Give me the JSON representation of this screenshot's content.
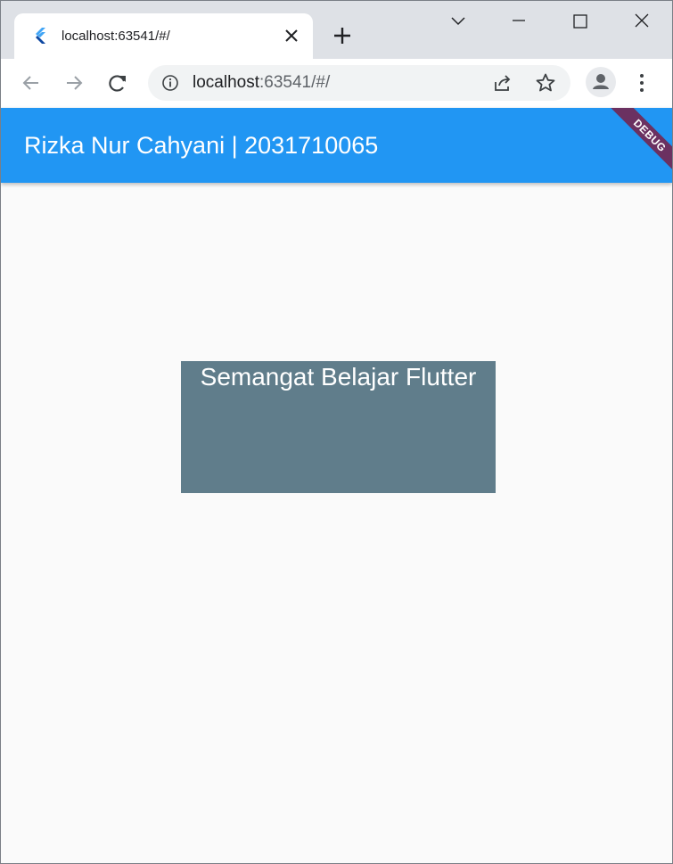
{
  "browser": {
    "tab_title": "localhost:63541/#/",
    "url_host": "localhost",
    "url_rest": ":63541/#/"
  },
  "app": {
    "title": "Rizka Nur Cahyani | 2031710065",
    "debug_label": "DEBUG",
    "box_text": "Semangat Belajar Flutter"
  },
  "colors": {
    "appbar": "#2196f3",
    "box": "#607d8b",
    "debug_ribbon": "#801437"
  },
  "icons": [
    "flutter-favicon-icon",
    "close-tab-icon",
    "new-tab-icon",
    "tab-search-icon",
    "minimize-icon",
    "maximize-icon",
    "close-window-icon",
    "back-icon",
    "forward-icon",
    "reload-icon",
    "info-icon",
    "share-icon",
    "star-icon",
    "profile-icon",
    "menu-icon"
  ]
}
